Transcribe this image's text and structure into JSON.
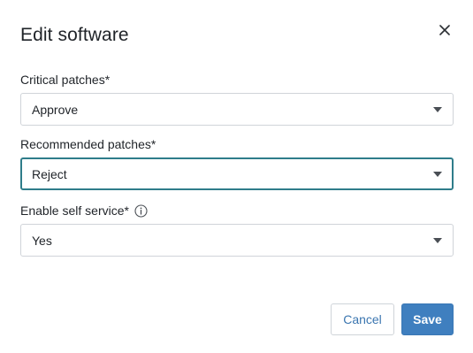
{
  "dialog": {
    "title": "Edit software",
    "close_icon": "close-icon"
  },
  "fields": {
    "critical": {
      "label": "Critical patches*",
      "value": "Approve"
    },
    "recommended": {
      "label": "Recommended patches*",
      "value": "Reject"
    },
    "self_service": {
      "label": "Enable self service*",
      "value": "Yes",
      "info_icon": "info-icon"
    }
  },
  "buttons": {
    "cancel": "Cancel",
    "save": "Save"
  },
  "colors": {
    "focus_border": "#2f7d8a",
    "primary": "#3f7fbf",
    "link": "#3b76b0"
  }
}
